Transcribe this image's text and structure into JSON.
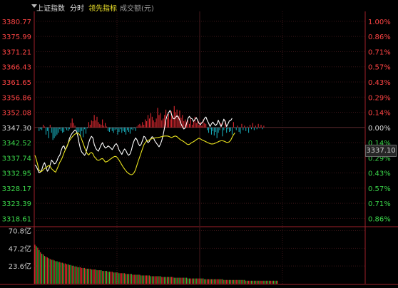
{
  "header": {
    "index_name": "上证指数",
    "mode": "分时",
    "indicator": "领先指标",
    "volume_label": "成交额(元)"
  },
  "current_price_tag": "3337.10",
  "colors": {
    "up": "#ff4444",
    "down": "#3bd64a",
    "base": "#d7d7d7",
    "price_line": "#ffffff",
    "leading_line": "#e9e31e",
    "axis": "#a0202a",
    "grid": "#3a1518",
    "vol_up": "#e8292f",
    "vol_down": "#24c93a",
    "breadth_up": "#ee2c34",
    "breadth_down": "#19b6c4"
  },
  "chart_data": {
    "type": "line",
    "price_axis": {
      "ylim": [
        3316.0,
        3383.0
      ],
      "left_ticks": [
        "3380.77",
        "3375.99",
        "3371.21",
        "3366.43",
        "3361.65",
        "3356.86",
        "3352.08",
        "3347.30",
        "3342.52",
        "3337.74",
        "3332.95",
        "3328.17",
        "3323.39",
        "3318.61"
      ],
      "right_ticks": [
        "1.00%",
        "0.86%",
        "0.71%",
        "0.57%",
        "0.43%",
        "0.29%",
        "0.14%",
        "0.00%",
        "0.14%",
        "0.29%",
        "0.43%",
        "0.57%",
        "0.71%",
        "0.86%"
      ]
    },
    "volume_axis": {
      "ylim": [
        0,
        76
      ],
      "ticks": [
        "70.8亿",
        "47.2亿",
        "23.6亿"
      ]
    },
    "time_points": 240,
    "series": [
      {
        "values": [
          3335.5,
          3335.0,
          3334.0,
          3333.0,
          3333.2,
          3334.0,
          3335.5,
          3336.2,
          3334.8,
          3333.5,
          3334.0,
          3335.5,
          3337.0,
          3336.5,
          3335.8,
          3336.0,
          3336.8,
          3338.0,
          3338.5,
          3340.0,
          3341.2,
          3341.5,
          3340.3,
          3341.0,
          3342.2,
          3343.8,
          3344.8,
          3345.5,
          3346.0,
          3346.5,
          3346.2,
          3344.8,
          3342.4,
          3340.5,
          3339.5,
          3339.0,
          3338.5,
          3339.2,
          3341.0,
          3342.5,
          3343.8,
          3344.5,
          3344.0,
          3342.0,
          3340.8,
          3340.2,
          3339.8,
          3340.8,
          3341.8,
          3342.5,
          3341.5,
          3340.8,
          3341.0,
          3341.5,
          3341.2,
          3340.8,
          3340.3,
          3341.0,
          3341.8,
          3342.2,
          3341.5,
          3340.2,
          3339.5,
          3338.8,
          3339.8,
          3340.5,
          3340.0,
          3339.0,
          3338.5,
          3339.0,
          3340.2,
          3342.0,
          3343.2,
          3344.0,
          3343.4,
          3342.2,
          3341.5,
          3342.0,
          3343.2,
          3344.5,
          3344.2,
          3343.2,
          3342.5,
          3342.9,
          3343.8,
          3344.4,
          3344.0,
          3343.0,
          3342.4,
          3341.8,
          3341.2,
          3342.0,
          3343.2,
          3345.0,
          3347.2,
          3349.8,
          3351.2,
          3352.0,
          3352.7,
          3351.5,
          3350.2,
          3350.0,
          3350.5,
          3351.0,
          3350.6,
          3349.6,
          3348.4,
          3347.5,
          3346.8,
          3347.2,
          3348.6,
          3350.2,
          3350.8,
          3350.2,
          3350.0,
          3349.2,
          3349.8,
          3350.4,
          3349.6,
          3348.6,
          3348.2,
          3348.8,
          3349.2,
          3350.2,
          3350.6,
          3349.5,
          3348.6,
          3347.6,
          3348.4,
          3349.0,
          3348.4,
          3347.9,
          3348.4,
          3349.6,
          3348.5,
          3347.6,
          3348.6,
          3349.9,
          3349.1,
          3347.6,
          3348.4,
          3349.4,
          3349.5,
          3350.2
        ],
        "name": ""
      },
      {
        "values": [
          3338.5,
          3337.2,
          3335.5,
          3333.8,
          3333.4,
          3333.5,
          3333.9,
          3334.4,
          3334.5,
          3335.0,
          3335.3,
          3335.0,
          3334.3,
          3333.9,
          3333.5,
          3333.2,
          3334.2,
          3335.2,
          3336.3,
          3337.0,
          3338.0,
          3339.2,
          3340.2,
          3341.2,
          3342.2,
          3343.1,
          3343.8,
          3344.3,
          3344.8,
          3345.2,
          3345.4,
          3345.6,
          3345.2,
          3344.6,
          3343.4,
          3342.2,
          3341.0,
          3339.8,
          3339.0,
          3338.6,
          3339.2,
          3339.4,
          3339.0,
          3338.1,
          3337.6,
          3337.1,
          3336.9,
          3337.1,
          3337.4,
          3337.5,
          3337.0,
          3336.4,
          3336.5,
          3336.7,
          3337.1,
          3337.4,
          3337.7,
          3338.0,
          3338.2,
          3338.1,
          3337.6,
          3337.0,
          3336.3,
          3335.5,
          3334.8,
          3334.2,
          3333.6,
          3333.1,
          3332.8,
          3332.5,
          3332.4,
          3332.6,
          3333.1,
          3334.0,
          3335.4,
          3336.8,
          3338.0,
          3339.3,
          3340.6,
          3341.8,
          3342.5,
          3343.0,
          3343.2,
          3343.4,
          3343.6,
          3343.8,
          3343.9,
          3344.0,
          3344.1,
          3344.1,
          3344.2,
          3344.3,
          3344.4,
          3344.5,
          3344.6,
          3344.6,
          3344.6,
          3344.5,
          3344.3,
          3344.1,
          3344.3,
          3344.5,
          3344.6,
          3344.4,
          3344.0,
          3343.6,
          3343.3,
          3343.1,
          3342.8,
          3342.5,
          3342.1,
          3341.9,
          3342.0,
          3342.3,
          3342.6,
          3342.8,
          3343.1,
          3343.4,
          3343.7,
          3343.9,
          3343.7,
          3343.4,
          3343.2,
          3343.0,
          3342.8,
          3342.6,
          3342.4,
          3342.2,
          3342.1,
          3342.1,
          3342.2,
          3342.4,
          3342.6,
          3342.8,
          3343.0,
          3343.1,
          3343.1,
          3343.0,
          3342.8,
          3342.6,
          3342.6,
          3342.8,
          3343.3,
          3344.2,
          3345.0,
          3345.6
        ],
        "name": ""
      }
    ],
    "breadth_bars": [
      0,
      0,
      0,
      -4,
      -2,
      -3,
      3,
      1,
      -8,
      -4,
      -12,
      3,
      -6,
      -14,
      -12,
      -10,
      -8,
      -6,
      -2,
      -4,
      -6,
      -5,
      -1,
      -3,
      -4,
      -2,
      5,
      10,
      5,
      2,
      -3,
      -6,
      -5,
      -9,
      -4,
      -11,
      -2,
      -7,
      -1,
      6,
      3,
      8,
      7,
      14,
      8,
      12,
      6,
      4,
      3,
      9,
      2,
      5,
      1,
      -4,
      -5,
      -2,
      -4,
      -6,
      -3,
      -2,
      -8,
      -5,
      -2,
      -6,
      -4,
      -5,
      -8,
      -3,
      -5,
      -7,
      -2,
      -3,
      -1,
      -4,
      1,
      3,
      4,
      2,
      6,
      3,
      9,
      7,
      14,
      10,
      16,
      12,
      8,
      6,
      10,
      22,
      14,
      16,
      8,
      10,
      14,
      20,
      11,
      15,
      9,
      18,
      12,
      24,
      17,
      20,
      13,
      19,
      11,
      14,
      7,
      9,
      6,
      8,
      4,
      11,
      3,
      7,
      12,
      5,
      8,
      3,
      6,
      2,
      9,
      5,
      4,
      -3,
      -6,
      -2,
      -8,
      -4,
      -9,
      -5,
      -12,
      -6,
      -3,
      5,
      -10,
      -3,
      8,
      -6,
      -2,
      -5,
      -4,
      -8,
      6,
      -1,
      -3,
      2,
      -5,
      -7,
      4,
      -3,
      2,
      -4,
      1,
      -6,
      3,
      -2,
      5,
      -3,
      2,
      -2,
      4,
      -1,
      3,
      -2,
      2
    ],
    "volume": [
      52,
      50,
      48,
      45,
      42,
      40,
      39,
      37,
      36,
      35,
      34,
      33,
      32,
      32,
      31,
      30,
      30,
      29,
      29,
      28,
      28,
      27,
      27,
      26,
      26,
      25,
      25,
      24,
      24,
      23,
      23,
      22,
      22,
      22,
      21,
      21,
      21,
      20,
      20,
      20,
      20,
      19,
      19,
      19,
      19,
      18,
      18,
      18,
      18,
      17,
      17,
      17,
      17,
      16,
      16,
      16,
      16,
      15,
      15,
      15,
      15,
      14,
      14,
      14,
      14,
      14,
      13,
      13,
      13,
      13,
      13,
      12,
      12,
      12,
      12,
      12,
      12,
      11,
      11,
      11,
      11,
      11,
      11,
      11,
      10,
      10,
      10,
      10,
      10,
      10,
      10,
      10,
      9,
      9,
      9,
      9,
      9,
      9,
      9,
      9,
      9,
      8,
      8,
      8,
      8,
      8,
      8,
      8,
      8,
      8,
      8,
      7,
      7,
      7,
      7,
      7,
      7,
      7,
      7,
      7,
      7,
      7,
      7,
      6,
      6,
      6,
      6,
      6,
      6,
      6,
      6,
      6,
      6,
      6,
      6,
      6,
      6,
      5,
      5,
      5,
      5,
      5,
      5,
      5,
      5,
      5,
      5,
      5,
      5,
      5,
      5,
      5,
      5,
      4,
      4,
      4,
      4,
      4,
      4,
      4,
      4,
      4,
      4,
      4,
      4,
      4,
      4,
      4,
      4,
      4,
      4,
      4,
      4,
      4,
      4,
      4,
      4
    ],
    "volume_up_flags": [
      1,
      0,
      1,
      0,
      1,
      0,
      1,
      0,
      1,
      1,
      0,
      1,
      0,
      1,
      0,
      1,
      0,
      0,
      1,
      0,
      1,
      0,
      1,
      1,
      0,
      1,
      0,
      1,
      0,
      1,
      0,
      1,
      0,
      1,
      1,
      0,
      1,
      0,
      1,
      0,
      1,
      0,
      1,
      1,
      0,
      1,
      0,
      1,
      0,
      1,
      0,
      1,
      0,
      1,
      0,
      1,
      1,
      0,
      1,
      0,
      1,
      0,
      1,
      1,
      0,
      1,
      0,
      1,
      0,
      1,
      0,
      1,
      1,
      0,
      1,
      0,
      1,
      0,
      1,
      0,
      1,
      1,
      0,
      1,
      0,
      1,
      0,
      1,
      1,
      0,
      1,
      0,
      1,
      1,
      0,
      1,
      0,
      1,
      0,
      1,
      1,
      0,
      1,
      0,
      1,
      0,
      1,
      1,
      0,
      1,
      0,
      1,
      0,
      1,
      1,
      0,
      1,
      0,
      1,
      1,
      0,
      1,
      0,
      1,
      0,
      1,
      1,
      0,
      1,
      0,
      1,
      0,
      1,
      1,
      0,
      1,
      0,
      1,
      0,
      1,
      1,
      0,
      1,
      0,
      1,
      0,
      1,
      1,
      0,
      1,
      0,
      1,
      0,
      1,
      0,
      1,
      1,
      0,
      1,
      0,
      1,
      0,
      1,
      0,
      1,
      1,
      0,
      1,
      0,
      1,
      0,
      1,
      1,
      0,
      1,
      0,
      1,
      0,
      1
    ]
  }
}
